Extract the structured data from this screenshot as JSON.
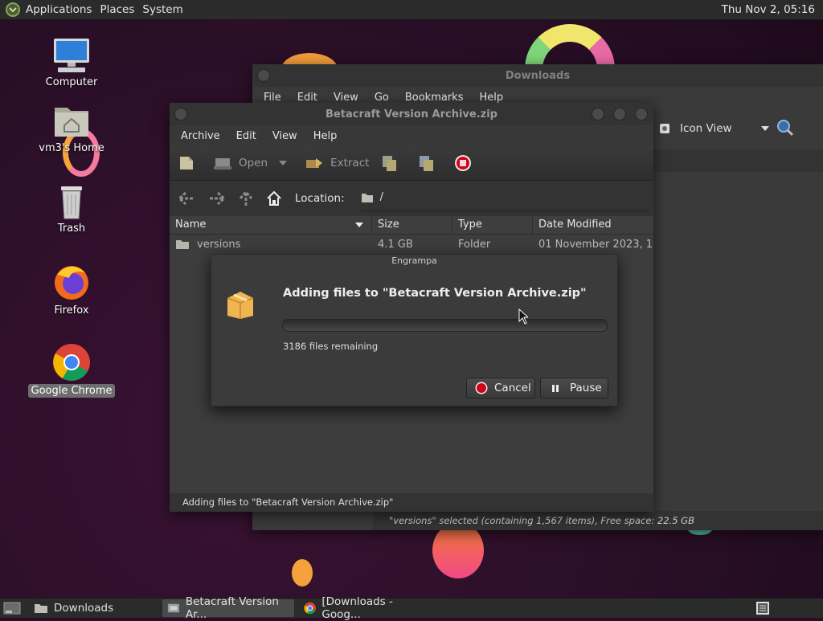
{
  "top_panel": {
    "menus": [
      "Applications",
      "Places",
      "System"
    ],
    "clock": "Thu Nov  2, 05:16"
  },
  "desktop": {
    "icons": [
      {
        "label": "Computer",
        "icon": "computer-icon"
      },
      {
        "label": "vm3's Home",
        "icon": "home-folder-icon"
      },
      {
        "label": "Trash",
        "icon": "trash-icon"
      },
      {
        "label": "Firefox",
        "icon": "firefox-icon"
      },
      {
        "label": "Google Chrome",
        "icon": "chrome-icon",
        "selected": true
      }
    ]
  },
  "downloads_window": {
    "title": "Downloads",
    "menus": [
      "File",
      "Edit",
      "View",
      "Go",
      "Bookmarks",
      "Help"
    ],
    "view_mode": "Icon View",
    "status": "\"versions\" selected (containing 1,567 items), Free space: 22.5 GB"
  },
  "archive_window": {
    "title": "Betacraft Version Archive.zip",
    "menus": [
      "Archive",
      "Edit",
      "View",
      "Help"
    ],
    "toolbar": {
      "open_label": "Open",
      "extract_label": "Extract"
    },
    "location_label": "Location:",
    "location_path": "/",
    "columns": [
      "Name",
      "Size",
      "Type",
      "Date Modified"
    ],
    "rows": [
      {
        "name": "versions",
        "size": "4.1 GB",
        "type": "Folder",
        "modified": "01 November 2023, 1..."
      }
    ],
    "status": "Adding files to \"Betacraft Version Archive.zip\""
  },
  "dialog": {
    "title": "Engrampa",
    "heading": "Adding files to \"Betacraft Version Archive.zip\"",
    "progress_fraction": 0,
    "remaining": "3186 files remaining",
    "cancel_label": "Cancel",
    "pause_label": "Pause"
  },
  "taskbar": {
    "tasks": [
      {
        "label": "Downloads",
        "active": false
      },
      {
        "label": "Betacraft Version Ar...",
        "active": true
      },
      {
        "label": "[Downloads - Goog...",
        "active": false
      }
    ]
  },
  "colors": {
    "accent": "#5a7fb5",
    "panel": "#2b2b2b",
    "window": "#3c3c3c",
    "cancel_red": "#d0021b"
  }
}
